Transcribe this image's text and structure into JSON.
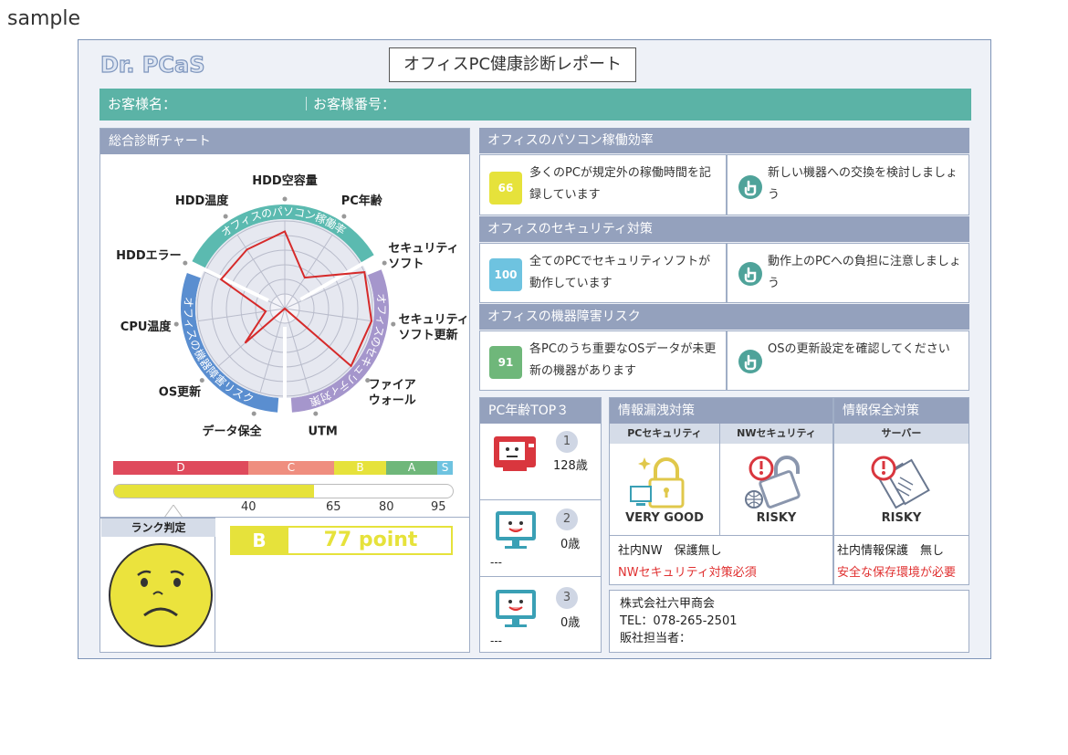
{
  "watermark": "sample",
  "header": {
    "logo": "Dr. PCaS",
    "report_title": "オフィスPC健康診断レポート",
    "customer_name_label": "お客様名：",
    "customer_number_label": "｜お客様番号："
  },
  "chart_section": {
    "title": "総合診断チャート",
    "ring_labels": [
      "オフィスのパソコン稼働率",
      "オフィスのセキュリティ対策",
      "オフィスの機器障害リスク"
    ],
    "rank_bands": [
      {
        "label": "D",
        "color": "#df4a5c"
      },
      {
        "label": "C",
        "color": "#ef8e7f"
      },
      {
        "label": "B",
        "color": "#e6e23b"
      },
      {
        "label": "A",
        "color": "#6fb77a"
      },
      {
        "label": "S",
        "color": "#6ec3e0"
      }
    ],
    "score_value": 77,
    "score_max": 100,
    "ticks": [
      "40",
      "65",
      "80",
      "95"
    ],
    "rank_label": "ランク判定",
    "grade": "B",
    "points_text": "77 point"
  },
  "chart_data": {
    "type": "radar",
    "categories": [
      "HDD空容量",
      "PC年齢",
      "セキュリティソフト",
      "セキュリティソフト更新",
      "ファイアウォール",
      "UTM",
      "データ保全",
      "OS更新",
      "CPU温度",
      "HDDエラー",
      "HDD温度"
    ],
    "category_display": [
      "HDD空容量",
      "PC年齢",
      "セキュリティ\nソフト",
      "セキュリティ\nソフト更新",
      "ファイア\nウォール",
      "UTM",
      "データ保全",
      "OS更新",
      "CPU温度",
      "HDDエラー",
      "HDD温度"
    ],
    "values": [
      88,
      42,
      100,
      100,
      100,
      0,
      0,
      60,
      22,
      80,
      80
    ],
    "rlim": [
      0,
      100
    ],
    "grid": true
  },
  "efficiency": {
    "title": "オフィスのパソコン稼働効率",
    "score": "66",
    "score_color": "#e6e23b",
    "message": "多くのPCが規定外の稼働時間を記録しています",
    "advice": "新しい機器への交換を検討しましょう"
  },
  "security": {
    "title": "オフィスのセキュリティ対策",
    "score": "100",
    "score_color": "#6ec3e0",
    "message": "全てのPCでセキュリティソフトが動作しています",
    "advice": "動作上のPCへの負担に注意しましょう"
  },
  "failure_risk": {
    "title": "オフィスの機器障害リスク",
    "score": "91",
    "score_color": "#6fb77a",
    "message": "各PCのうち重要なOSデータが未更新の機器があります",
    "advice": "OSの更新設定を確認してください"
  },
  "pc_age": {
    "title": "PC年齢TOP３",
    "items": [
      {
        "rank": "1",
        "age": "128歳",
        "name": ""
      },
      {
        "rank": "2",
        "age": "0歳",
        "name": "---"
      },
      {
        "rank": "3",
        "age": "0歳",
        "name": "---"
      }
    ]
  },
  "leak": {
    "title": "情報漏洩対策",
    "pc_security_label": "PCセキュリティ",
    "nw_security_label": "NWセキュリティ",
    "pc_status": "VERY GOOD",
    "nw_status": "RISKY",
    "note": "社内NW　保護無し",
    "warning": "NWセキュリティ対策必須"
  },
  "preserve": {
    "title": "情報保全対策",
    "server_label": "サーバー",
    "server_status": "RISKY",
    "note": "社内情報保護　無し",
    "warning": "安全な保存環境が必要"
  },
  "vendor": {
    "company": "株式会社六甲商会",
    "tel": "TEL：078-265-2501",
    "contact": "販社担当者："
  },
  "colors": {
    "accent": "#5bb3a6",
    "header": "#94a1bd",
    "radar_line": "#d62a2a",
    "ring_teal": "#5bbab0",
    "ring_purple": "#a596cc",
    "ring_blue": "#5a8ed0"
  }
}
